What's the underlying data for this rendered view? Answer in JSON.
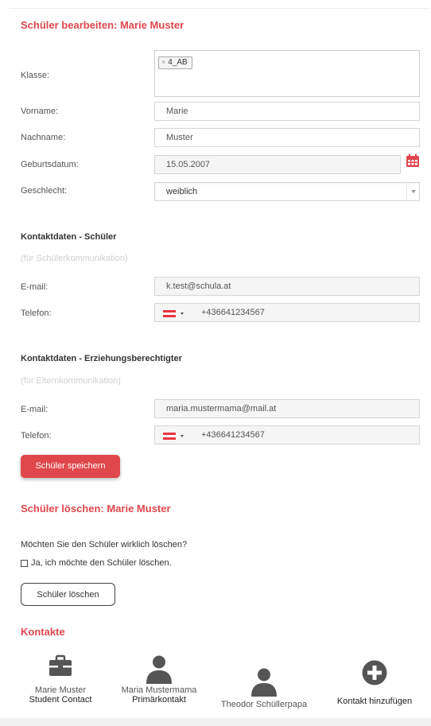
{
  "edit": {
    "title": "Schüler bearbeiten: Marie Muster",
    "klasse_label": "Klasse:",
    "klasse_tag": "4_AB",
    "tag_remove": "×",
    "vorname_label": "Vorname:",
    "vorname_value": "Marie",
    "nachname_label": "Nachname:",
    "nachname_value": "Muster",
    "geburtsdatum_label": "Geburtsdatum:",
    "geburtsdatum_value": "15.05.2007",
    "geschlecht_label": "Geschlecht:",
    "geschlecht_value": "weiblich"
  },
  "student_contact": {
    "title": "Kontaktdaten - Schüler",
    "hint": "(für Schülerkommunikation)",
    "email_label": "E-mail:",
    "email_value": "k.test@schula.at",
    "phone_label": "Telefon:",
    "phone_value": "+436641234567"
  },
  "guardian_contact": {
    "title": "Kontaktdaten - Erziehungsberechtigter",
    "hint": "(für Elternkommunikation)",
    "email_label": "E-mail:",
    "email_value": "maria.mustermama@mail.at",
    "phone_label": "Telefon:",
    "phone_value": "+436641234567"
  },
  "save_button": "Schüler speichern",
  "delete": {
    "title": "Schüler löschen: Marie Muster",
    "question": "Möchten Sie den Schüler wirklich löschen?",
    "confirm_label": "Ja, ich möchte den Schüler löschen.",
    "button": "Schüler löschen"
  },
  "contacts": {
    "title": "Kontakte",
    "items": [
      {
        "name": "Marie Muster",
        "role": "Student Contact",
        "icon": "briefcase-icon"
      },
      {
        "name": "Maria Mustermama",
        "role": "Primärkontakt",
        "icon": "person-icon"
      },
      {
        "name": "Theodor Schüllerpapa",
        "role": "",
        "icon": "person-icon"
      },
      {
        "name": "",
        "role": "Kontakt hinzufügen",
        "icon": "plus-circle-icon"
      }
    ]
  },
  "colors": {
    "accent": "#e0474c",
    "icon_grey": "#555555"
  }
}
